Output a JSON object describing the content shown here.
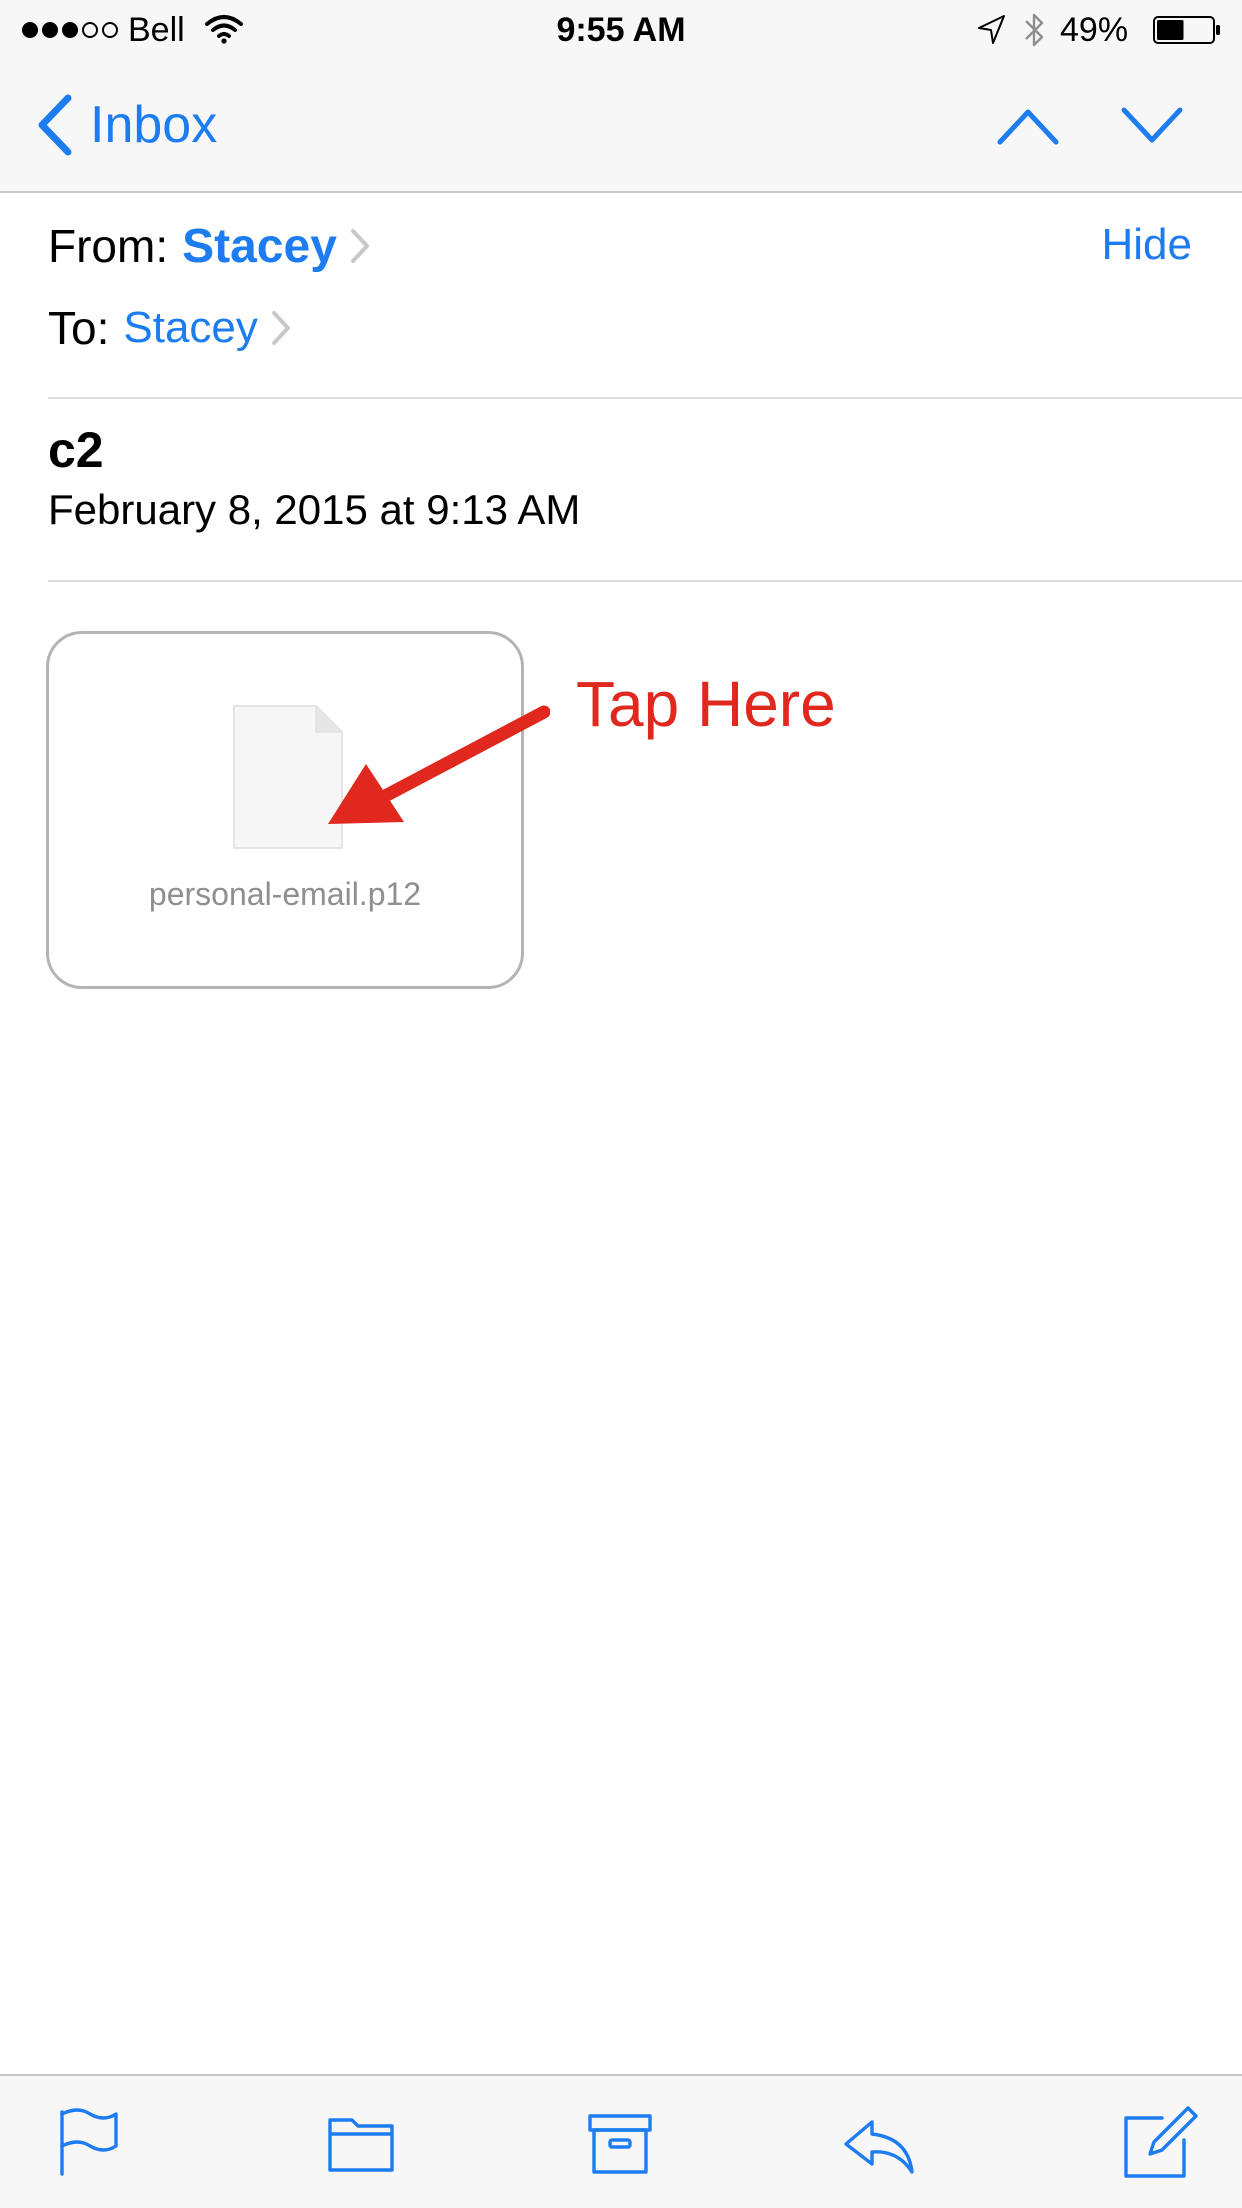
{
  "status_bar": {
    "carrier": "Bell",
    "time": "9:55 AM",
    "battery_percent": "49%",
    "signal_bars_filled": 3,
    "signal_bars_total": 5,
    "battery_level": 0.49
  },
  "nav": {
    "back_label": "Inbox",
    "icons": [
      "chevron-left-icon",
      "chevron-up-icon",
      "chevron-down-icon"
    ]
  },
  "header": {
    "from_label": "From:",
    "from_name": "Stacey",
    "to_label": "To:",
    "to_name": "Stacey",
    "hide_label": "Hide"
  },
  "message": {
    "subject": "c2",
    "date": "February 8, 2015 at 9:13 AM"
  },
  "attachment": {
    "filename": "personal-email.p12",
    "icon": "document-icon"
  },
  "annotation": {
    "label": "Tap Here",
    "color": "#e0281e"
  },
  "toolbar": {
    "icons": [
      "flag-icon",
      "folder-icon",
      "archive-icon",
      "reply-icon",
      "compose-icon"
    ]
  },
  "colors": {
    "accent": "#1c7cf0",
    "bar_background": "#f7f7f7",
    "separator": "#c8c7cc"
  }
}
